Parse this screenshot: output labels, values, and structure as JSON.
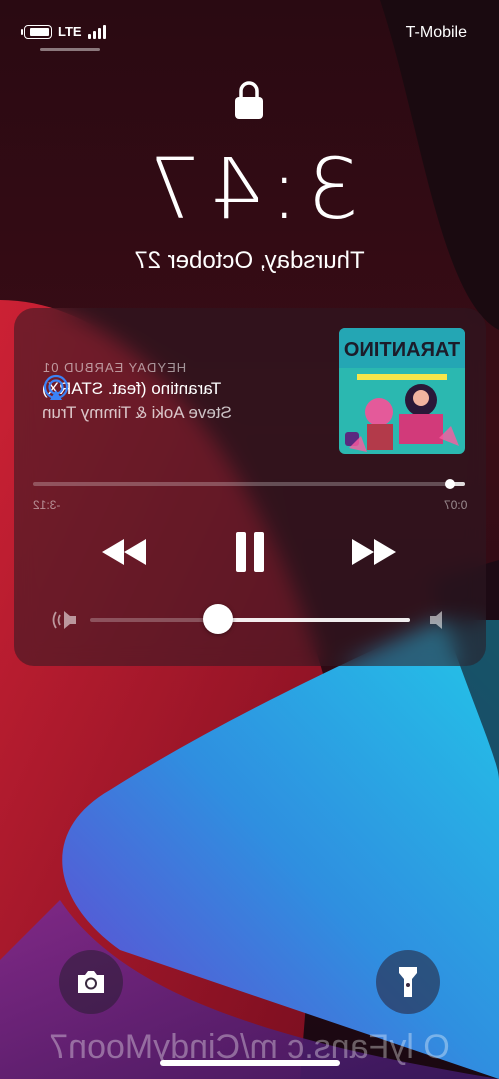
{
  "status_bar": {
    "carrier": "T-Mobile",
    "network": "LTE",
    "battery_level": 0.85,
    "signal_bars": 4
  },
  "lock_screen": {
    "time": "3:47",
    "date": "Thursday, October 27"
  },
  "now_playing": {
    "source": "HEYDAY EARBUD 01",
    "song": "Tarantino (feat. STARX)",
    "artist": "Steve Aoki & Timmy Trun",
    "elapsed": "0:07",
    "remaining": "-3:12",
    "progress": 0.035,
    "volume": 0.6,
    "album_art_title": "TARANTINO",
    "icons": {
      "airplay": "airplay-icon",
      "rewind": "rewind-icon",
      "pause": "pause-icon",
      "forward": "fast-forward-icon",
      "volume_low": "speaker-low-icon",
      "volume_high": "speaker-high-icon"
    }
  },
  "quick_actions": {
    "flashlight": "flashlight-icon",
    "camera": "camera-icon"
  },
  "watermark": "O lyFans.c m/CindyMoon7",
  "colors": {
    "accent_airplay": "#3b82f6"
  }
}
